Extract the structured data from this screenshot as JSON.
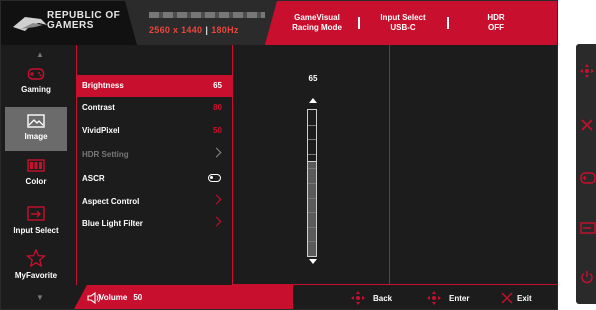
{
  "header": {
    "brand": "REPUBLIC OF GAMERS",
    "brand_line1": "REPUBLIC OF",
    "brand_line2": "GAMERS",
    "resolution": "2560 x 1440",
    "refresh": "180Hz",
    "mode_line1": "GameVisual",
    "mode_line2": "Racing Mode",
    "input_line1": "Input Select",
    "input_line2": "USB-C",
    "hdr_line1": "HDR",
    "hdr_line2": "OFF"
  },
  "main_menu": {
    "items": [
      {
        "label": "Gaming",
        "icon": "gamepad-icon"
      },
      {
        "label": "Image",
        "icon": "image-icon"
      },
      {
        "label": "Color",
        "icon": "color-icon"
      },
      {
        "label": "Input Select",
        "icon": "input-icon"
      },
      {
        "label": "MyFavorite",
        "icon": "star-icon"
      }
    ],
    "selected": "Image"
  },
  "sub_menu": {
    "items": [
      {
        "label": "Brightness",
        "value": "65"
      },
      {
        "label": "Contrast",
        "value": "80"
      },
      {
        "label": "VividPixel",
        "value": "50"
      },
      {
        "label": "HDR Setting",
        "value": ""
      },
      {
        "label": "ASCR",
        "value": ""
      },
      {
        "label": "Aspect Control",
        "value": ""
      },
      {
        "label": "Blue Light Filter",
        "value": ""
      }
    ],
    "selected": "Brightness"
  },
  "slider": {
    "value": "65",
    "fraction": 0.65
  },
  "footer": {
    "volume_label": "Volume",
    "volume_value": "50",
    "back_label": "Back",
    "enter_label": "Enter",
    "exit_label": "Exit"
  },
  "colors": {
    "accent": "#c8102e",
    "background": "#1c1c1c",
    "selected_nav": "#6b6b6b"
  }
}
